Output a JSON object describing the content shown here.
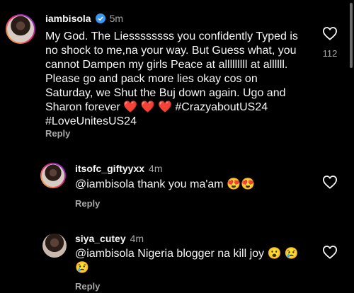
{
  "comments": [
    {
      "username": "iambisola",
      "verified": true,
      "time": "5m",
      "text_a": "My God. The Liessssssss you confidently Typed is",
      "text_b": "no shock to me,na your way. But Guess what, you",
      "text_c": "cannot Dampen my girls Peace at alllllllll at allllll.",
      "text_d": "Please go and pack more lies okay cos on",
      "text_e": "Saturday, we Shut the Buj down again. Ugo and",
      "text_f_start": "Sharon forever",
      "text_f_emojis": "❤️ ❤️ ❤️",
      "text_f_tag": "#CrazyaboutUS24",
      "text_g": "#LoveUnitesUS24",
      "reply_label": "Reply",
      "like_count": "112"
    },
    {
      "username": "itsofc_giftyyxx",
      "time": "4m",
      "mention": "@iambisola",
      "text": "thank you ma'am",
      "emojis": "😍😍",
      "reply_label": "Reply"
    },
    {
      "username": "siya_cutey",
      "time": "4m",
      "mention": "@iambisola",
      "text": "Nigeria blogger na kill joy",
      "emojis_a": "😮 😢",
      "emojis_b": "😢",
      "reply_label": "Reply"
    }
  ],
  "colors": {
    "background": "#000000",
    "text": "#f5f5f5",
    "muted": "#a8a8a8",
    "verified": "#3897f0"
  },
  "icons": [
    "heart-icon",
    "verified-icon"
  ]
}
